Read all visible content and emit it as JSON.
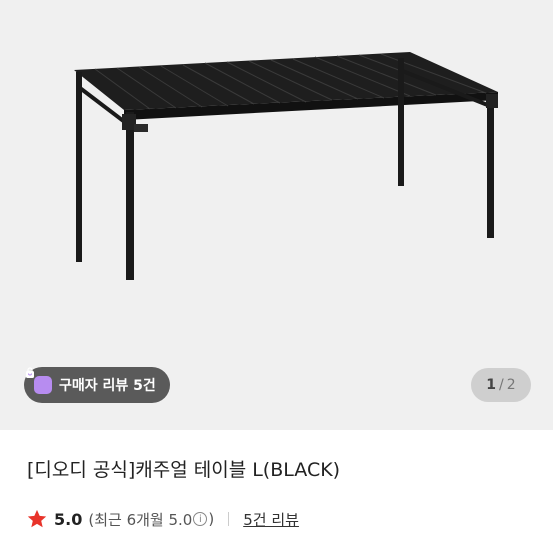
{
  "product_image": {
    "subject": "black-folding-table"
  },
  "review_chip": {
    "label": "구매자 리뷰 5건",
    "icon": "shopping-bag-icon",
    "accent": "#b78cf0"
  },
  "pagination": {
    "current": "1",
    "separator": "/",
    "total": "2"
  },
  "product": {
    "title": "[디오디 공식]캐주얼 테이블 L(BLACK)"
  },
  "rating": {
    "icon": "star-icon",
    "star_color": "#e8332a",
    "score": "5.0",
    "recent_open": "(최근 6개월 5.0",
    "info_glyph": "i",
    "recent_close": ")",
    "review_count_label": "5건 리뷰"
  }
}
